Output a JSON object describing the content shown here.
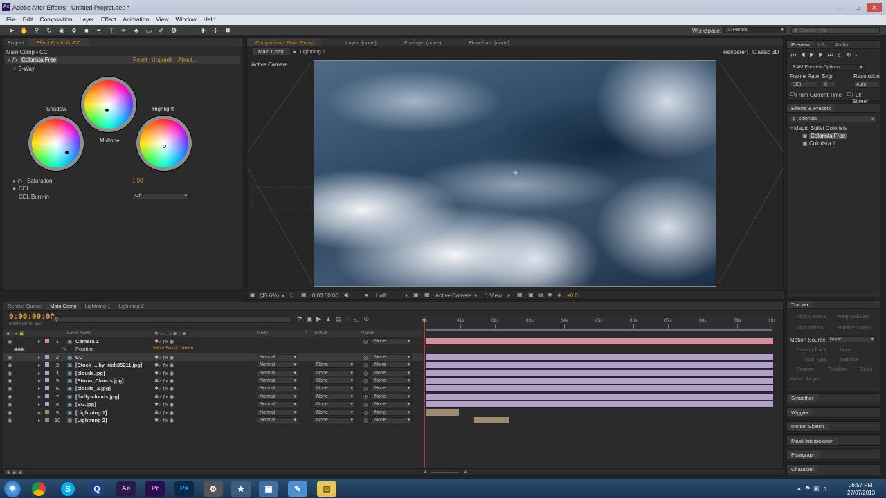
{
  "window": {
    "title": "Adobe After Effects - Untitled Project.aep *",
    "app_badge": "Ae"
  },
  "menu": [
    "File",
    "Edit",
    "Composition",
    "Layer",
    "Effect",
    "Animation",
    "View",
    "Window",
    "Help"
  ],
  "workspace": {
    "label": "Workspace:",
    "value": "All Panels"
  },
  "search_help": {
    "placeholder": "Search Help"
  },
  "effect_controls": {
    "tabs": [
      "Project",
      "Effect Controls: CC"
    ],
    "subject": "Main Comp • CC",
    "effect_name": "Colorista Free",
    "links": [
      "Reset",
      "Upgrade",
      "About..."
    ],
    "group": "3-Way",
    "wheels": [
      "Shadow",
      "Midtone",
      "Highlight"
    ],
    "saturation_label": "Saturation",
    "saturation_value": "1.00",
    "cdl_label": "CDL",
    "cdl_burnin_label": "CDL Burn-in",
    "cdl_burnin_value": "Off"
  },
  "comp_viewer": {
    "tabs": [
      "Composition: Main Comp",
      "Layer: (none)",
      "Footage: (none)",
      "Flowchart: (none)"
    ],
    "nav": [
      "Main Comp",
      "Lightning 1"
    ],
    "renderer_label": "Renderer:",
    "renderer_value": "Classic 3D",
    "camera_label": "Active Camera",
    "footer": {
      "zoom": "(45.6%)",
      "timecode": "0:00:00:00",
      "resolution": "Half",
      "camera": "Active Camera",
      "view": "1 View",
      "exposure": "+0.0"
    }
  },
  "preview": {
    "tabs": [
      "Preview",
      "Info",
      "Audio"
    ],
    "ram_options": "RAM Preview Options",
    "frame_rate_label": "Frame Rate",
    "skip_label": "Skip",
    "resolution_label": "Resolution",
    "frame_rate": "(30)",
    "skip": "0",
    "resolution": "Auto",
    "from_current": "From Current Time",
    "full_screen": "Full Screen"
  },
  "effects_presets": {
    "title": "Effects & Presets",
    "search": "colorista",
    "folder": "Magic Bullet Colorista",
    "items": [
      "Colorista Free",
      "Colorista II"
    ]
  },
  "timeline": {
    "tabs": [
      "Render Queue",
      "Main Comp",
      "Lightning 1",
      "Lightning 2"
    ],
    "timecode": "0:00:00:00",
    "fps": "00000 (24.00 fps)",
    "col_headers": {
      "layer_name": "Layer Name",
      "mode": "Mode",
      "t": "T",
      "trkmat": "TrkMat",
      "parent": "Parent"
    },
    "ruler": [
      "0s",
      "01s",
      "02s",
      "03s",
      "04s",
      "05s",
      "06s",
      "07s",
      "08s",
      "09s",
      "10s"
    ],
    "layers": [
      {
        "num": "1",
        "name": "Camera 1",
        "mode": "",
        "trkmat": "",
        "parent": "None",
        "color": "#d98ea0"
      },
      {
        "num": "",
        "name": "Position",
        "mode": "",
        "trkmat": "",
        "parent": "",
        "value": "960.0,540.0,-1866.6",
        "color": ""
      },
      {
        "num": "2",
        "name": "CC",
        "mode": "Normal",
        "trkmat": "",
        "parent": "None",
        "color": "#b1a1c6"
      },
      {
        "num": "3",
        "name": "[Stock_...by_rich35211.jpg]",
        "mode": "Normal",
        "trkmat": "None",
        "parent": "None",
        "color": "#b1a1c6"
      },
      {
        "num": "4",
        "name": "[clouds.jpg]",
        "mode": "Normal",
        "trkmat": "None",
        "parent": "None",
        "color": "#b1a1c6"
      },
      {
        "num": "5",
        "name": "[Storm_Clouds.jpg]",
        "mode": "Normal",
        "trkmat": "None",
        "parent": "None",
        "color": "#b1a1c6"
      },
      {
        "num": "6",
        "name": "[clouds_2.jpg]",
        "mode": "Normal",
        "trkmat": "None",
        "parent": "None",
        "color": "#b1a1c6"
      },
      {
        "num": "7",
        "name": "[fluffy-clouds.jpg]",
        "mode": "Normal",
        "trkmat": "None",
        "parent": "None",
        "color": "#b1a1c6"
      },
      {
        "num": "8",
        "name": "[BG.jpg]",
        "mode": "Normal",
        "trkmat": "None",
        "parent": "None",
        "color": "#b1a1c6"
      },
      {
        "num": "9",
        "name": "[Lightning 1]",
        "mode": "Normal",
        "trkmat": "None",
        "parent": "None",
        "color": "#9c8b70"
      },
      {
        "num": "10",
        "name": "[Lightning 2]",
        "mode": "Normal",
        "trkmat": "None",
        "parent": "None",
        "color": "#9c8b70"
      }
    ]
  },
  "tracker": {
    "title": "Tracker",
    "buttons": [
      "Track Camera",
      "Warp Stabilizer",
      "Track Motion",
      "Stabilize Motion"
    ],
    "motion_source_label": "Motion Source:",
    "motion_source_value": "None",
    "current_track_label": "Current Track:",
    "current_track_value": "None",
    "track_type_label": "Track Type:",
    "track_type_value": "Stabilize",
    "options": [
      "Position",
      "Rotation",
      "Scale"
    ],
    "motion_target": "Motion Target:"
  },
  "side_panels": [
    "Smoother",
    "Wiggler",
    "Motion Sketch",
    "Mask Interpolation",
    "Paragraph",
    "Character"
  ],
  "taskbar": {
    "time": "06:57 PM",
    "date": "27/07/2013"
  }
}
